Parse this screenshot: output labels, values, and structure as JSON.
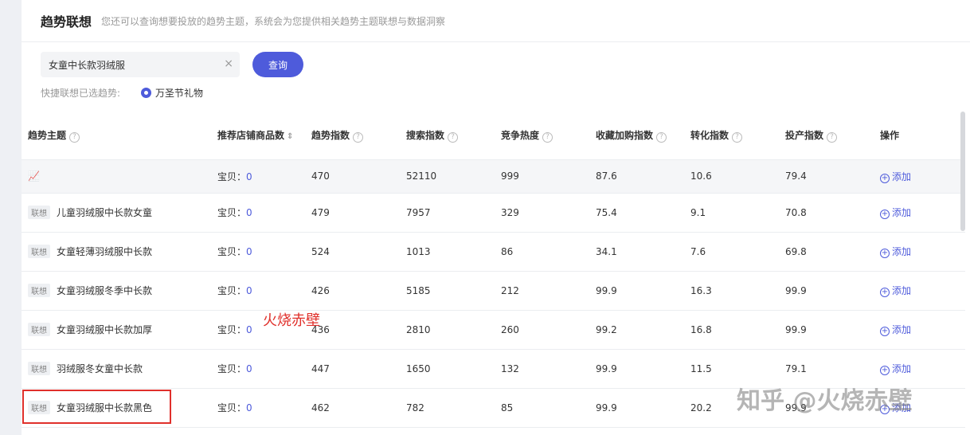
{
  "header": {
    "title": "趋势联想",
    "subtitle": "您还可以查询想要投放的趋势主题，系统会为您提供相关趋势主题联想与数据洞察"
  },
  "search": {
    "value": "女童中长款羽绒服",
    "clear_label": "×",
    "button_label": "查询"
  },
  "quick": {
    "label": "快捷联想已选趋势:",
    "option": "万圣节礼物"
  },
  "table": {
    "columns": [
      "趋势主题",
      "推荐店铺商品数",
      "趋势指数",
      "搜索指数",
      "竞争热度",
      "收藏加购指数",
      "转化指数",
      "投产指数",
      "操作"
    ],
    "count_prefix": "宝贝：",
    "tag_label": "联想",
    "add_label": "添加",
    "rows": [
      {
        "topic": "",
        "count": "0",
        "trend": "470",
        "search": "52110",
        "compete": "999",
        "fav": "87.6",
        "convert": "10.6",
        "roi": "79.4"
      },
      {
        "topic": "儿童羽绒服中长款女童",
        "count": "0",
        "trend": "479",
        "search": "7957",
        "compete": "329",
        "fav": "75.4",
        "convert": "9.1",
        "roi": "70.8"
      },
      {
        "topic": "女童轻薄羽绒服中长款",
        "count": "0",
        "trend": "524",
        "search": "1013",
        "compete": "86",
        "fav": "34.1",
        "convert": "7.6",
        "roi": "69.8"
      },
      {
        "topic": "女童羽绒服冬季中长款",
        "count": "0",
        "trend": "426",
        "search": "5185",
        "compete": "212",
        "fav": "99.9",
        "convert": "16.3",
        "roi": "99.9"
      },
      {
        "topic": "女童羽绒服中长款加厚",
        "count": "0",
        "trend": "436",
        "search": "2810",
        "compete": "260",
        "fav": "99.2",
        "convert": "16.8",
        "roi": "99.9"
      },
      {
        "topic": "羽绒服冬女童中长款",
        "count": "0",
        "trend": "447",
        "search": "1650",
        "compete": "132",
        "fav": "99.9",
        "convert": "11.5",
        "roi": "79.1"
      },
      {
        "topic": "女童羽绒服中长款黑色",
        "count": "0",
        "trend": "462",
        "search": "782",
        "compete": "85",
        "fav": "99.9",
        "convert": "20.2",
        "roi": "99.9"
      }
    ]
  },
  "watermarks": {
    "red_text": "火烧赤壁",
    "zhihu_text": "知乎 @火烧赤壁"
  }
}
